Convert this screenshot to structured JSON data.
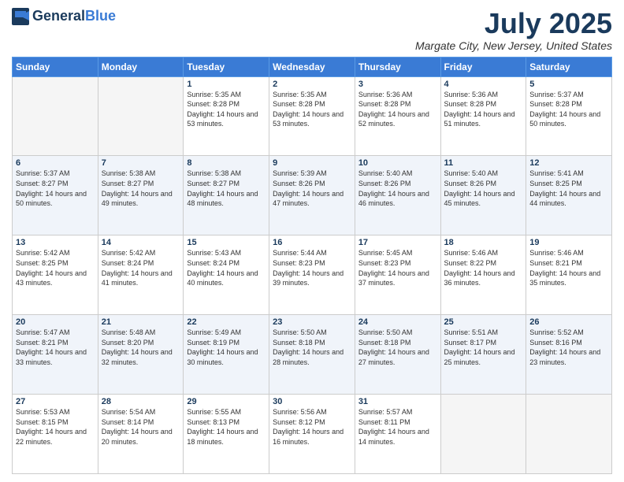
{
  "header": {
    "logo_general": "General",
    "logo_blue": "Blue",
    "month": "July 2025",
    "location": "Margate City, New Jersey, United States"
  },
  "weekdays": [
    "Sunday",
    "Monday",
    "Tuesday",
    "Wednesday",
    "Thursday",
    "Friday",
    "Saturday"
  ],
  "weeks": [
    [
      {
        "day": "",
        "empty": true
      },
      {
        "day": "",
        "empty": true
      },
      {
        "day": "1",
        "sunrise": "Sunrise: 5:35 AM",
        "sunset": "Sunset: 8:28 PM",
        "daylight": "Daylight: 14 hours and 53 minutes."
      },
      {
        "day": "2",
        "sunrise": "Sunrise: 5:35 AM",
        "sunset": "Sunset: 8:28 PM",
        "daylight": "Daylight: 14 hours and 53 minutes."
      },
      {
        "day": "3",
        "sunrise": "Sunrise: 5:36 AM",
        "sunset": "Sunset: 8:28 PM",
        "daylight": "Daylight: 14 hours and 52 minutes."
      },
      {
        "day": "4",
        "sunrise": "Sunrise: 5:36 AM",
        "sunset": "Sunset: 8:28 PM",
        "daylight": "Daylight: 14 hours and 51 minutes."
      },
      {
        "day": "5",
        "sunrise": "Sunrise: 5:37 AM",
        "sunset": "Sunset: 8:28 PM",
        "daylight": "Daylight: 14 hours and 50 minutes."
      }
    ],
    [
      {
        "day": "6",
        "sunrise": "Sunrise: 5:37 AM",
        "sunset": "Sunset: 8:27 PM",
        "daylight": "Daylight: 14 hours and 50 minutes."
      },
      {
        "day": "7",
        "sunrise": "Sunrise: 5:38 AM",
        "sunset": "Sunset: 8:27 PM",
        "daylight": "Daylight: 14 hours and 49 minutes."
      },
      {
        "day": "8",
        "sunrise": "Sunrise: 5:38 AM",
        "sunset": "Sunset: 8:27 PM",
        "daylight": "Daylight: 14 hours and 48 minutes."
      },
      {
        "day": "9",
        "sunrise": "Sunrise: 5:39 AM",
        "sunset": "Sunset: 8:26 PM",
        "daylight": "Daylight: 14 hours and 47 minutes."
      },
      {
        "day": "10",
        "sunrise": "Sunrise: 5:40 AM",
        "sunset": "Sunset: 8:26 PM",
        "daylight": "Daylight: 14 hours and 46 minutes."
      },
      {
        "day": "11",
        "sunrise": "Sunrise: 5:40 AM",
        "sunset": "Sunset: 8:26 PM",
        "daylight": "Daylight: 14 hours and 45 minutes."
      },
      {
        "day": "12",
        "sunrise": "Sunrise: 5:41 AM",
        "sunset": "Sunset: 8:25 PM",
        "daylight": "Daylight: 14 hours and 44 minutes."
      }
    ],
    [
      {
        "day": "13",
        "sunrise": "Sunrise: 5:42 AM",
        "sunset": "Sunset: 8:25 PM",
        "daylight": "Daylight: 14 hours and 43 minutes."
      },
      {
        "day": "14",
        "sunrise": "Sunrise: 5:42 AM",
        "sunset": "Sunset: 8:24 PM",
        "daylight": "Daylight: 14 hours and 41 minutes."
      },
      {
        "day": "15",
        "sunrise": "Sunrise: 5:43 AM",
        "sunset": "Sunset: 8:24 PM",
        "daylight": "Daylight: 14 hours and 40 minutes."
      },
      {
        "day": "16",
        "sunrise": "Sunrise: 5:44 AM",
        "sunset": "Sunset: 8:23 PM",
        "daylight": "Daylight: 14 hours and 39 minutes."
      },
      {
        "day": "17",
        "sunrise": "Sunrise: 5:45 AM",
        "sunset": "Sunset: 8:23 PM",
        "daylight": "Daylight: 14 hours and 37 minutes."
      },
      {
        "day": "18",
        "sunrise": "Sunrise: 5:46 AM",
        "sunset": "Sunset: 8:22 PM",
        "daylight": "Daylight: 14 hours and 36 minutes."
      },
      {
        "day": "19",
        "sunrise": "Sunrise: 5:46 AM",
        "sunset": "Sunset: 8:21 PM",
        "daylight": "Daylight: 14 hours and 35 minutes."
      }
    ],
    [
      {
        "day": "20",
        "sunrise": "Sunrise: 5:47 AM",
        "sunset": "Sunset: 8:21 PM",
        "daylight": "Daylight: 14 hours and 33 minutes."
      },
      {
        "day": "21",
        "sunrise": "Sunrise: 5:48 AM",
        "sunset": "Sunset: 8:20 PM",
        "daylight": "Daylight: 14 hours and 32 minutes."
      },
      {
        "day": "22",
        "sunrise": "Sunrise: 5:49 AM",
        "sunset": "Sunset: 8:19 PM",
        "daylight": "Daylight: 14 hours and 30 minutes."
      },
      {
        "day": "23",
        "sunrise": "Sunrise: 5:50 AM",
        "sunset": "Sunset: 8:18 PM",
        "daylight": "Daylight: 14 hours and 28 minutes."
      },
      {
        "day": "24",
        "sunrise": "Sunrise: 5:50 AM",
        "sunset": "Sunset: 8:18 PM",
        "daylight": "Daylight: 14 hours and 27 minutes."
      },
      {
        "day": "25",
        "sunrise": "Sunrise: 5:51 AM",
        "sunset": "Sunset: 8:17 PM",
        "daylight": "Daylight: 14 hours and 25 minutes."
      },
      {
        "day": "26",
        "sunrise": "Sunrise: 5:52 AM",
        "sunset": "Sunset: 8:16 PM",
        "daylight": "Daylight: 14 hours and 23 minutes."
      }
    ],
    [
      {
        "day": "27",
        "sunrise": "Sunrise: 5:53 AM",
        "sunset": "Sunset: 8:15 PM",
        "daylight": "Daylight: 14 hours and 22 minutes."
      },
      {
        "day": "28",
        "sunrise": "Sunrise: 5:54 AM",
        "sunset": "Sunset: 8:14 PM",
        "daylight": "Daylight: 14 hours and 20 minutes."
      },
      {
        "day": "29",
        "sunrise": "Sunrise: 5:55 AM",
        "sunset": "Sunset: 8:13 PM",
        "daylight": "Daylight: 14 hours and 18 minutes."
      },
      {
        "day": "30",
        "sunrise": "Sunrise: 5:56 AM",
        "sunset": "Sunset: 8:12 PM",
        "daylight": "Daylight: 14 hours and 16 minutes."
      },
      {
        "day": "31",
        "sunrise": "Sunrise: 5:57 AM",
        "sunset": "Sunset: 8:11 PM",
        "daylight": "Daylight: 14 hours and 14 minutes."
      },
      {
        "day": "",
        "empty": true
      },
      {
        "day": "",
        "empty": true
      }
    ]
  ]
}
